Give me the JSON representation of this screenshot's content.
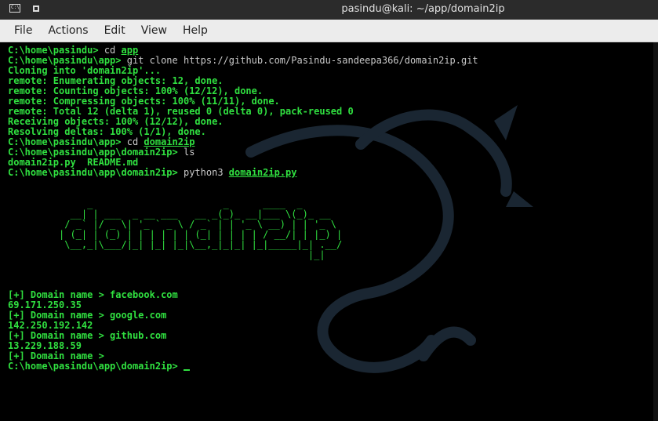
{
  "window": {
    "title": "pasindu@kali: ~/app/domain2ip",
    "icon_left": "terminal-icon",
    "icon_right": "pin-icon"
  },
  "menu": [
    "File",
    "Actions",
    "Edit",
    "View",
    "Help"
  ],
  "terminal": {
    "prompt_home": "C:\\home\\pasindu>",
    "prompt_app": "C:\\home\\pasindu\\app>",
    "prompt_proj": "C:\\home\\pasindu\\app\\domain2ip>",
    "cmd_cd": "cd",
    "arg_app": "app",
    "cmd_clone": "git clone https://github.com/Pasindu-sandeepa366/domain2ip.git",
    "clone_out": [
      "Cloning into 'domain2ip'...",
      "remote: Enumerating objects: 12, done.",
      "remote: Counting objects: 100% (12/12), done.",
      "remote: Compressing objects: 100% (11/11), done.",
      "remote: Total 12 (delta 1), reused 0 (delta 0), pack-reused 0",
      "Receiving objects: 100% (12/12), done.",
      "Resolving deltas: 100% (1/1), done."
    ],
    "arg_domain2ip": "domain2ip",
    "cmd_ls": "ls",
    "ls_out": "domain2ip.py  README.md",
    "cmd_python": "python3",
    "arg_script": "domain2ip.py",
    "banner": [
      "     _                       _      ____  _",
      "  __| | ___  _ __ ___   __ _(_)_ __|___ \\(_)_ __",
      " / _` |/ _ \\| '_ ` _ \\ / _` | | '_ \\ __) | | '_ \\",
      "| (_| | (_) | | | | | | (_| | | | | / __/| | |_) |",
      " \\__,_|\\___/|_| |_| |_|\\__,_|_|_| |_|_____|_| .__/",
      "                                            |_|"
    ],
    "session": [
      "[+] Domain name > facebook.com",
      "69.171.250.35",
      "[+] Domain name > google.com",
      "142.250.192.142",
      "[+] Domain name > github.com",
      "13.229.188.59",
      "[+] Domain name >"
    ]
  }
}
